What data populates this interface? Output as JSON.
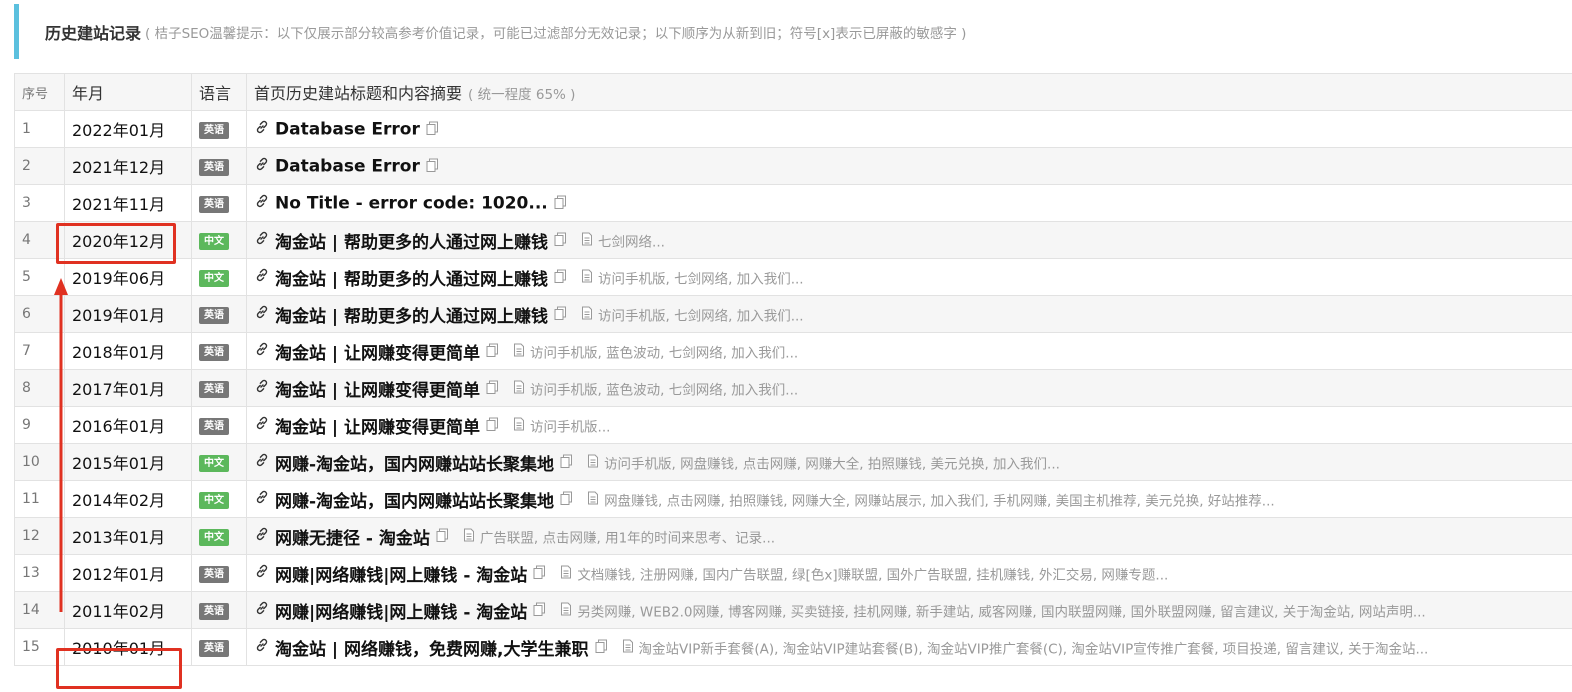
{
  "header": {
    "title": "历史建站记录",
    "note": "( 桔子SEO温馨提示：以下仅展示部分较高参考价值记录，可能已过滤部分无效记录；以下顺序为从新到旧；符号[x]表示已屏蔽的敏感字 )"
  },
  "table": {
    "columns": {
      "index": "序号",
      "date": "年月",
      "lang": "语言",
      "title": "首页历史建站标题和内容摘要",
      "title_note": "( 统一程度 65% )"
    },
    "rows": [
      {
        "index": "1",
        "date": "2022年01月",
        "lang": "英语",
        "lang_type": "en",
        "title": "Database Error",
        "summary": ""
      },
      {
        "index": "2",
        "date": "2021年12月",
        "lang": "英语",
        "lang_type": "en",
        "title": "Database Error",
        "summary": ""
      },
      {
        "index": "3",
        "date": "2021年11月",
        "lang": "英语",
        "lang_type": "en",
        "title": "No Title - error code: 1020...",
        "summary": ""
      },
      {
        "index": "4",
        "date": "2020年12月",
        "lang": "中文",
        "lang_type": "zh",
        "title": "淘金站 | 帮助更多的人通过网上赚钱",
        "summary": "七剑网络..."
      },
      {
        "index": "5",
        "date": "2019年06月",
        "lang": "中文",
        "lang_type": "zh",
        "title": "淘金站 | 帮助更多的人通过网上赚钱",
        "summary": "访问手机版, 七剑网络, 加入我们..."
      },
      {
        "index": "6",
        "date": "2019年01月",
        "lang": "英语",
        "lang_type": "en",
        "title": "淘金站 | 帮助更多的人通过网上赚钱",
        "summary": "访问手机版, 七剑网络, 加入我们..."
      },
      {
        "index": "7",
        "date": "2018年01月",
        "lang": "英语",
        "lang_type": "en",
        "title": "淘金站 | 让网赚变得更简单",
        "summary": "访问手机版, 蓝色波动, 七剑网络, 加入我们..."
      },
      {
        "index": "8",
        "date": "2017年01月",
        "lang": "英语",
        "lang_type": "en",
        "title": "淘金站 | 让网赚变得更简单",
        "summary": "访问手机版, 蓝色波动, 七剑网络, 加入我们..."
      },
      {
        "index": "9",
        "date": "2016年01月",
        "lang": "英语",
        "lang_type": "en",
        "title": "淘金站 | 让网赚变得更简单",
        "summary": "访问手机版..."
      },
      {
        "index": "10",
        "date": "2015年01月",
        "lang": "中文",
        "lang_type": "zh",
        "title": "网赚-淘金站，国内网赚站站长聚集地",
        "summary": "访问手机版, 网盘赚钱, 点击网赚, 网赚大全, 拍照赚钱, 美元兑换, 加入我们..."
      },
      {
        "index": "11",
        "date": "2014年02月",
        "lang": "中文",
        "lang_type": "zh",
        "title": "网赚-淘金站，国内网赚站站长聚集地",
        "summary": "网盘赚钱, 点击网赚, 拍照赚钱, 网赚大全, 网赚站展示, 加入我们, 手机网赚, 美国主机推荐, 美元兑换, 好站推荐..."
      },
      {
        "index": "12",
        "date": "2013年01月",
        "lang": "中文",
        "lang_type": "zh",
        "title": "网赚无捷径 - 淘金站",
        "summary": "广告联盟, 点击网赚, 用1年的时间来思考、记录..."
      },
      {
        "index": "13",
        "date": "2012年01月",
        "lang": "英语",
        "lang_type": "en",
        "title": "网赚|网络赚钱|网上赚钱 - 淘金站",
        "summary": "文档赚钱, 注册网赚, 国内广告联盟, 绿[色x]赚联盟, 国外广告联盟, 挂机赚钱, 外汇交易, 网赚专题..."
      },
      {
        "index": "14",
        "date": "2011年02月",
        "lang": "英语",
        "lang_type": "en",
        "title": "网赚|网络赚钱|网上赚钱 - 淘金站",
        "summary": "另类网赚, WEB2.0网赚, 博客网赚, 买卖链接, 挂机网赚, 新手建站, 威客网赚, 国内联盟网赚, 国外联盟网赚, 留言建议, 关于淘金站, 网站声明..."
      },
      {
        "index": "15",
        "date": "2010年01月",
        "lang": "英语",
        "lang_type": "en",
        "title": "淘金站 | 网络赚钱，免费网赚,大学生兼职",
        "summary": "淘金站VIP新手套餐(A), 淘金站VIP建站套餐(B), 淘金站VIP推广套餐(C), 淘金站VIP宣传推广套餐, 项目投递, 留言建议, 关于淘金站..."
      }
    ]
  },
  "colors": {
    "accent": "#5bc0de",
    "badge_en": "#777777",
    "badge_zh": "#5cb85c",
    "annotation": "#e03121"
  },
  "icons": {
    "title_link": "link-icon",
    "title_copy": "copy-icon",
    "summary": "document-icon"
  }
}
